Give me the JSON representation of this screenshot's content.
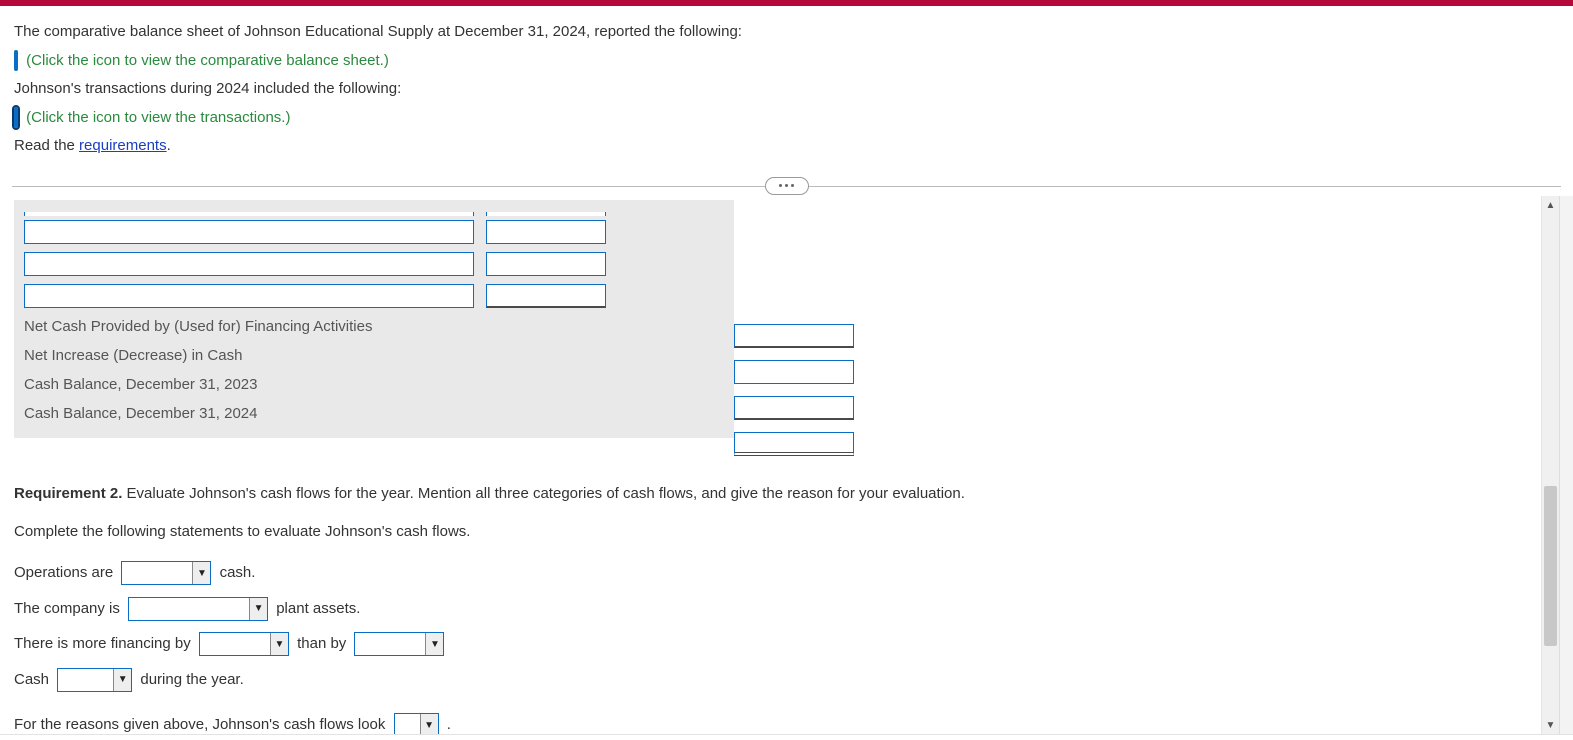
{
  "intro": {
    "line1": "The comparative balance sheet of Johnson Educational Supply at December 31, 2024, reported the following:",
    "balance_sheet_link": "(Click the icon to view the comparative balance sheet.)",
    "line2": "Johnson's transactions during 2024 included the following:",
    "transactions_link": "(Click the icon to view the transactions.)",
    "read_the": "Read the ",
    "requirements_link": "requirements",
    "period": "."
  },
  "worksheet": {
    "rows": {
      "net_cash_financing": "Net Cash Provided by (Used for) Financing Activities",
      "net_increase_decrease": "Net Increase (Decrease) in Cash",
      "cash_2023": "Cash Balance, December 31, 2023",
      "cash_2024": "Cash Balance, December 31, 2024"
    }
  },
  "req2": {
    "heading_bold": "Requirement 2.",
    "heading_rest": " Evaluate Johnson's cash flows for the year. Mention all three categories of cash flows, and give the reason for your evaluation.",
    "complete": "Complete the following statements to evaluate Johnson's cash flows.",
    "s1_pre": "Operations are ",
    "s1_post": " cash.",
    "s2_pre": "The company is ",
    "s2_post": " plant assets.",
    "s3_pre": "There is more financing by ",
    "s3_mid": " than by ",
    "s4_pre": "Cash ",
    "s4_post": " during the year.",
    "s5_pre": "For the reasons given above, Johnson's cash flows look ",
    "s5_post": "."
  }
}
